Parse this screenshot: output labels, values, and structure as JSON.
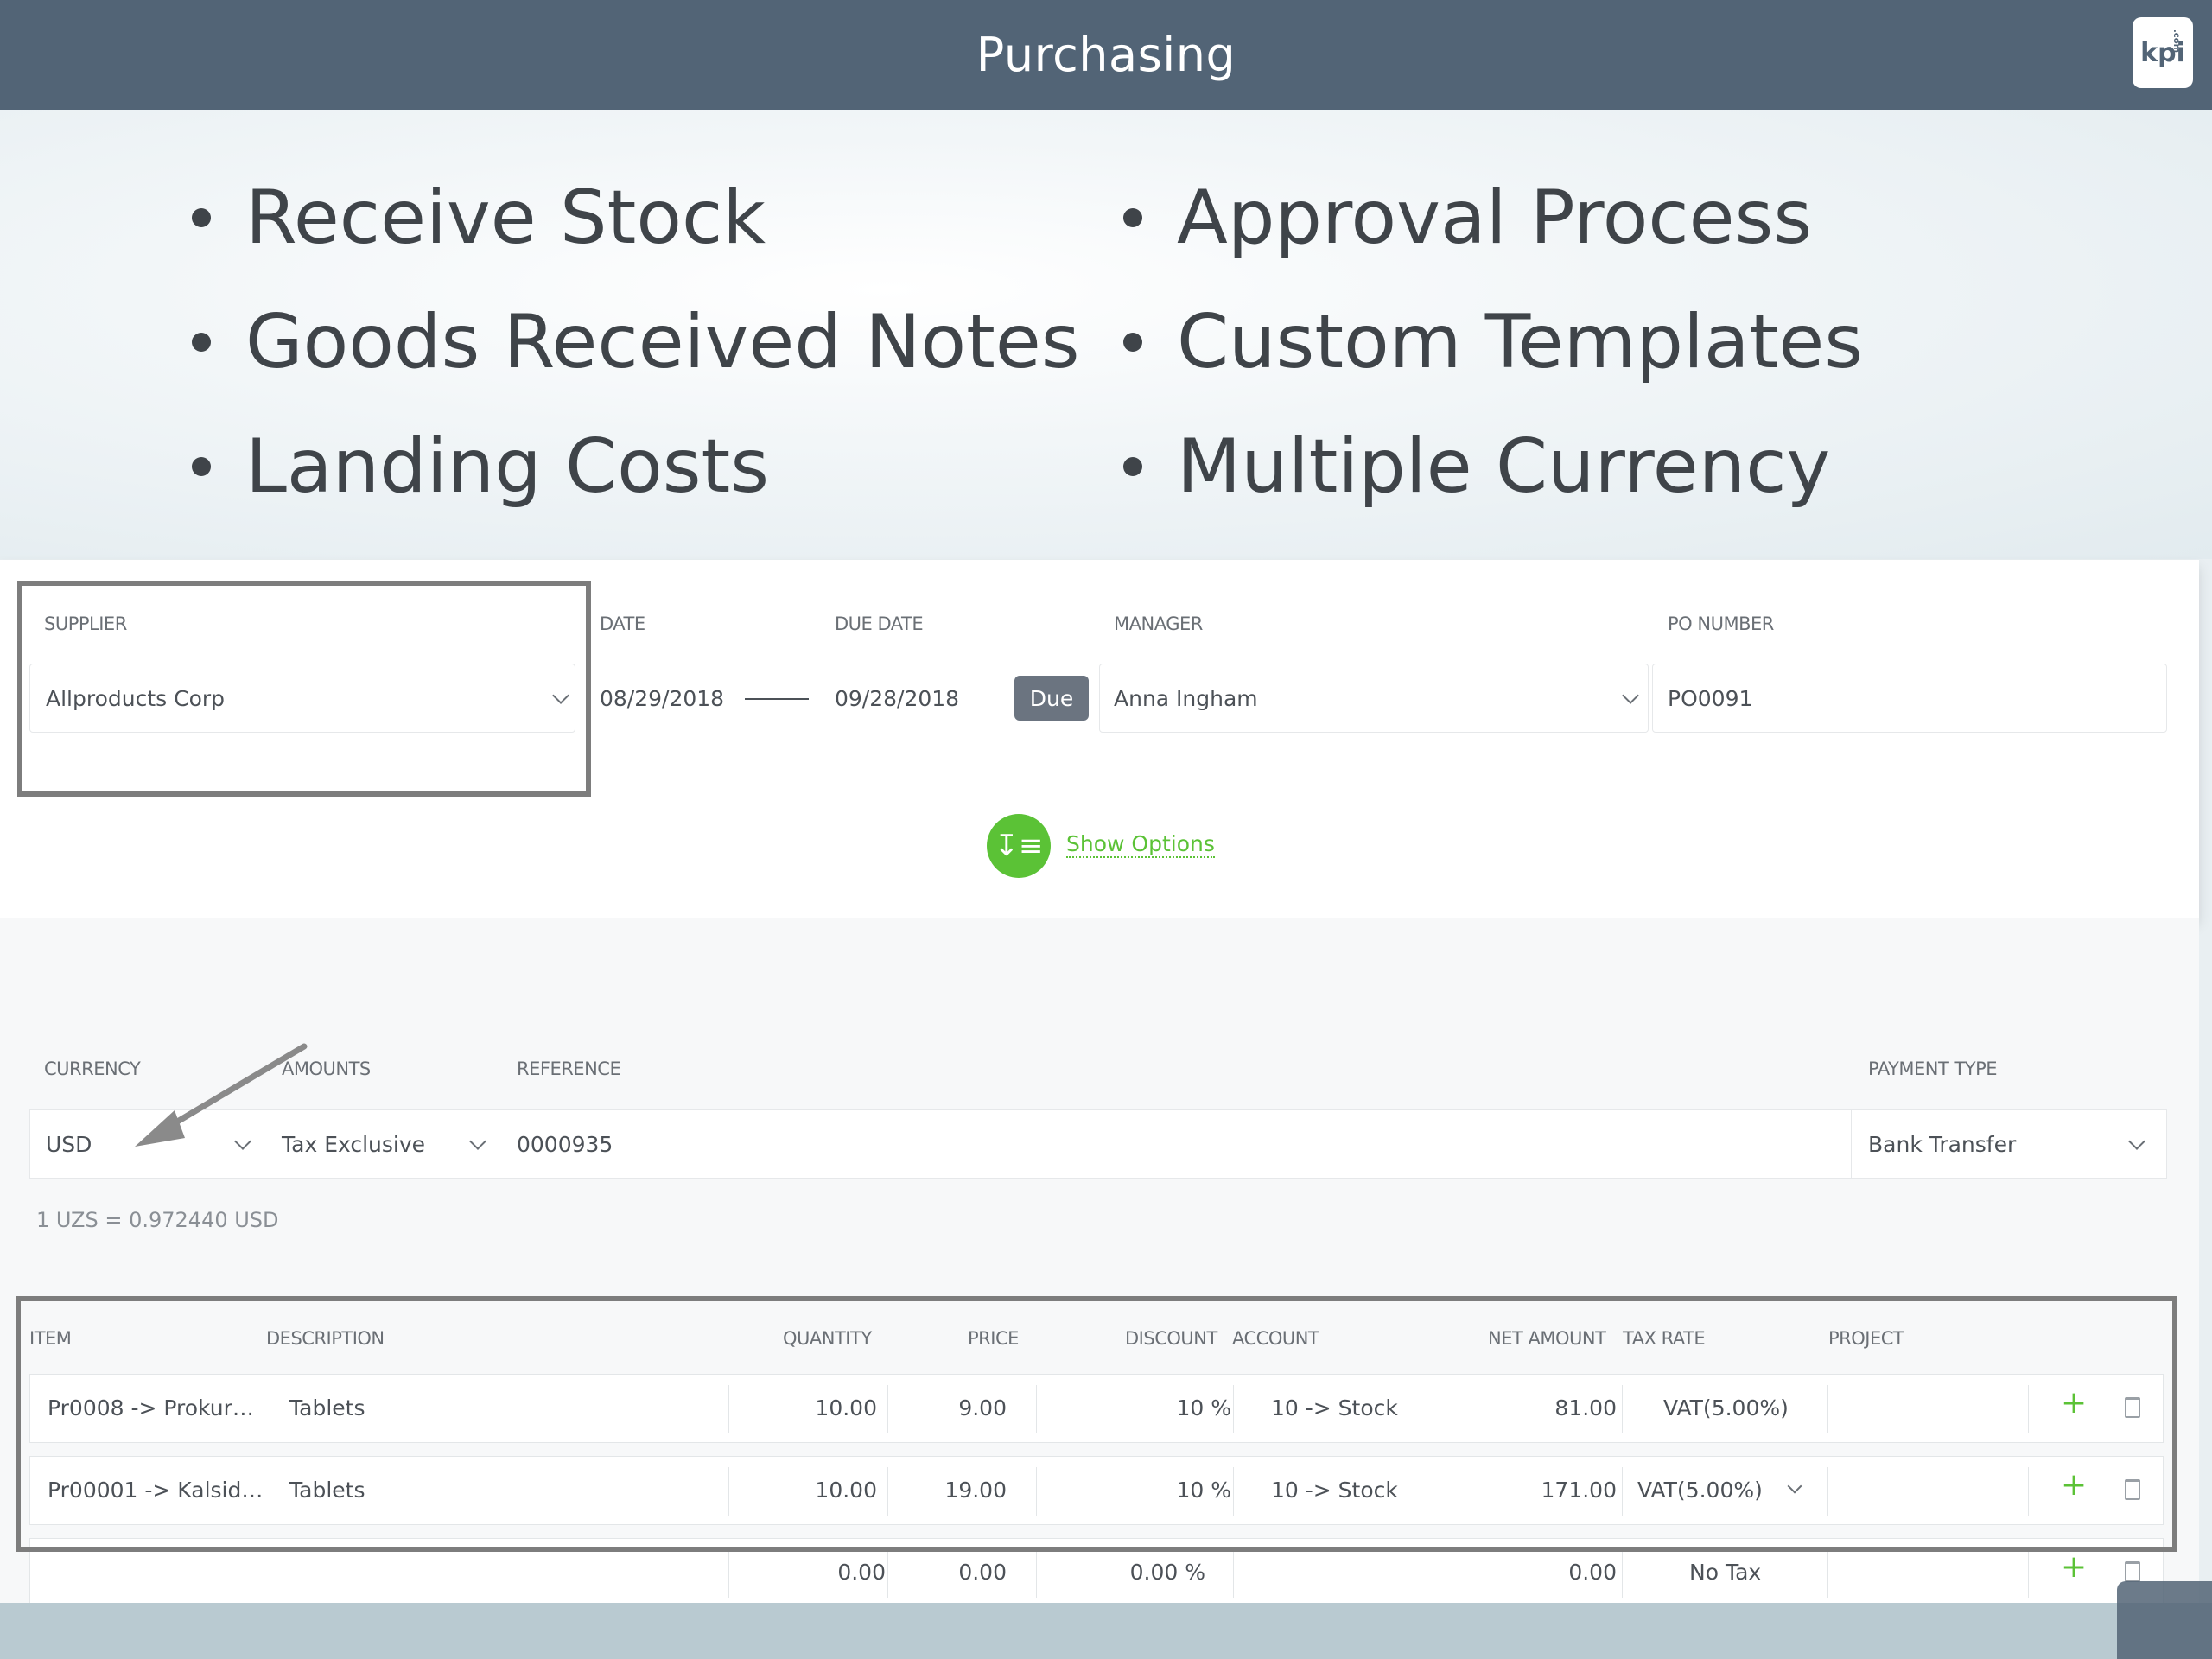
{
  "header": {
    "title": "Purchasing",
    "logo_text": "kpi",
    "logo_sub": ".com"
  },
  "bullets": {
    "left": [
      "Receive Stock",
      "Goods Received Notes",
      "Landing Costs"
    ],
    "right": [
      "Approval Process",
      "Custom Templates",
      "Multiple Currency"
    ]
  },
  "form": {
    "supplier_label": "SUPPLIER",
    "supplier_value": "Allproducts Corp",
    "date_label": "DATE",
    "date_value": "08/29/2018",
    "due_date_label": "DUE DATE",
    "due_date_value": "09/28/2018",
    "due_badge": "Due",
    "manager_label": "MANAGER",
    "manager_value": "Anna Ingham",
    "po_label": "PO NUMBER",
    "po_value": "PO0091",
    "show_options": "Show Options"
  },
  "section2": {
    "currency_label": "CURRENCY",
    "currency_value": "USD",
    "amounts_label": "AMOUNTS",
    "amounts_value": "Tax Exclusive",
    "reference_label": "REFERENCE",
    "reference_value": "0000935",
    "payment_label": "PAYMENT TYPE",
    "payment_value": "Bank Transfer",
    "rate_text": "1 UZS = 0.972440 USD"
  },
  "table": {
    "headers": [
      "ITEM",
      "DESCRIPTION",
      "QUANTITY",
      "PRICE",
      "DISCOUNT",
      "ACCOUNT",
      "NET AMOUNT",
      "TAX RATE",
      "PROJECT"
    ],
    "rows": [
      {
        "item": "Pr0008 -> Prokur…",
        "description": "Tablets",
        "quantity": "10.00",
        "price": "9.00",
        "discount": "10 %",
        "account": "10 -> Stock",
        "net": "81.00",
        "tax": "VAT(5.00%)"
      },
      {
        "item": "Pr00001 -> Kalsid…",
        "description": "Tablets",
        "quantity": "10.00",
        "price": "19.00",
        "discount": "10 %",
        "account": "10 -> Stock",
        "net": "171.00",
        "tax": "VAT(5.00%)"
      },
      {
        "item": "",
        "description": "",
        "quantity": "0.00",
        "price": "0.00",
        "discount": "0.00 %",
        "account": "",
        "net": "0.00",
        "tax": "No Tax"
      }
    ],
    "add_symbol": "+"
  },
  "colors": {
    "header": "#526476",
    "accent_green": "#5bc236",
    "highlight_border": "#7d7d7d"
  }
}
